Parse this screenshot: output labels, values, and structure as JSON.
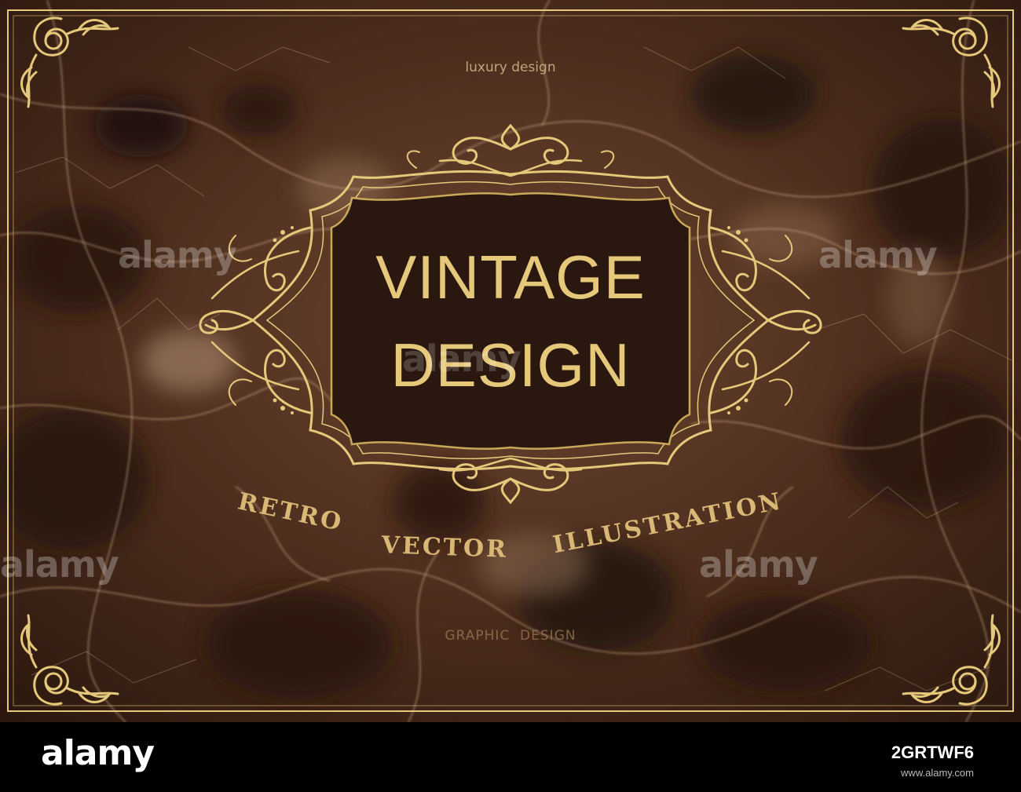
{
  "poster": {
    "tagline": "luxury design",
    "title_line1": "VINTAGE",
    "title_line2": "DESIGN",
    "subtitle_words": [
      "RETRO",
      "VECTOR",
      "ILLUSTRATION"
    ],
    "bottom_caption": "GRAPHIC  DESIGN"
  },
  "watermark": {
    "text": "alamy"
  },
  "footer": {
    "logo": "alamy",
    "image_id": "2GRTWF6",
    "url": "www.alamy.com"
  },
  "colors": {
    "gold": "#e5c87a",
    "gold_dark": "#c9a85a",
    "marble_base": "#4a2c1c",
    "label_fill": "#2a1810",
    "footer_bg": "#000000"
  }
}
